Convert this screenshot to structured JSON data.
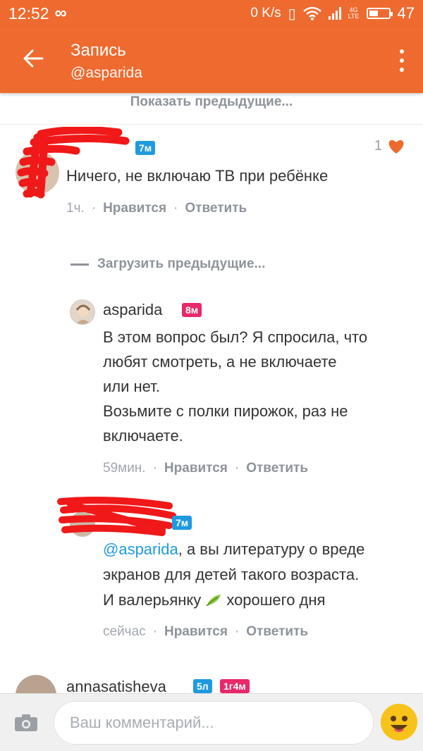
{
  "status_bar": {
    "time": "12:52",
    "speed": "0 K/s",
    "network": "4G LTE",
    "battery": "47",
    "battery_level": 0.47
  },
  "app_bar": {
    "title": "Запись",
    "subtitle": "@asparida"
  },
  "thread": {
    "show_previous": "Показать предыдущие...",
    "load_previous": "Загрузить предыдущие...",
    "comments": [
      {
        "author": "",
        "badge": "7м",
        "text": "Ничего, не включаю ТВ при ребёнке",
        "time": "1ч.",
        "likes": "1",
        "like_label": "Нравится",
        "reply_label": "Ответить"
      },
      {
        "author": "asparida",
        "badge": "8м",
        "text_lines": [
          "В этом вопрос был? Я спросила, что",
          "любят смотреть, а не включаете",
          "или нет.",
          "Возьмите с полки пирожок, раз не",
          "включаете."
        ],
        "time": "59мин.",
        "like_label": "Нравится",
        "reply_label": "Ответить"
      },
      {
        "author": "",
        "badge": "7м",
        "mention": "@asparida",
        "text_line1_rest": ", а вы литературу о вреде",
        "text_line2": "экранов для детей такого возраста.",
        "text_line3_before": "И валерьянку",
        "text_line3_after": "хорошего дня",
        "time": "сейчас",
        "like_label": "Нравится",
        "reply_label": "Ответить"
      },
      {
        "author": "annasatisheva",
        "badge1": "5л",
        "badge2": "1г4м"
      }
    ]
  },
  "comment_input": {
    "placeholder": "Ваш комментарий..."
  },
  "colors": {
    "brand": "#ee6a2e",
    "link": "#1f9ae0",
    "badge_pink": "#e8286a",
    "heart": "#ee6a2e"
  }
}
